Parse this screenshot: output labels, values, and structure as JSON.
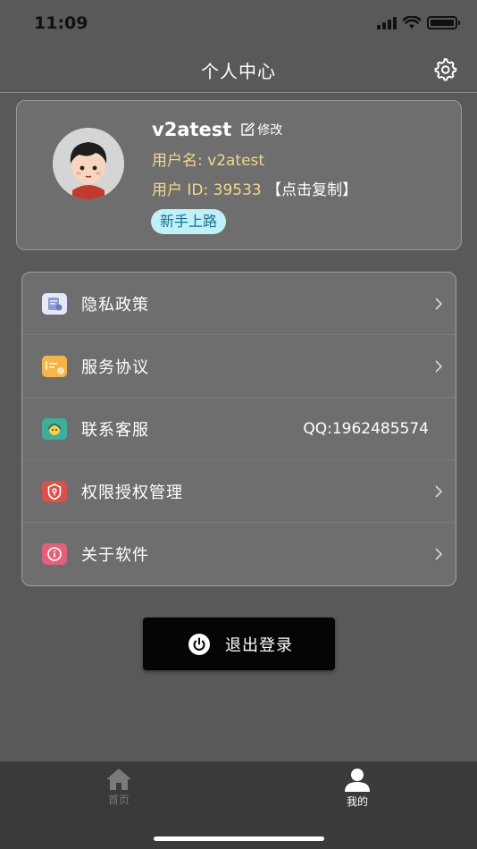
{
  "status_bar": {
    "time": "11:09"
  },
  "nav": {
    "title": "个人中心"
  },
  "profile": {
    "username": "v2atest",
    "edit_label": "修改",
    "username_line": "用户名: v2atest",
    "user_id_line": "用户 ID: 39533",
    "copy_label": "【点击复制】",
    "badge": "新手上路"
  },
  "menu": {
    "items": [
      {
        "label": "隐私政策",
        "icon": "privacy-policy-icon"
      },
      {
        "label": "服务协议",
        "icon": "service-agreement-icon"
      },
      {
        "label": "联系客服",
        "icon": "customer-service-icon",
        "value": "QQ:1962485574"
      },
      {
        "label": "权限授权管理",
        "icon": "permission-management-icon"
      },
      {
        "label": "关于软件",
        "icon": "about-icon"
      }
    ]
  },
  "logout": {
    "label": "退出登录"
  },
  "tabs": [
    {
      "label": "首页",
      "icon": "home-icon",
      "active": false
    },
    {
      "label": "我的",
      "icon": "profile-icon",
      "active": true
    }
  ],
  "colors": {
    "background": "#595959",
    "card": "#6e6e6e",
    "info_text": "#f0d98a",
    "badge_bg": "#bff1f6",
    "badge_text": "#1a6f92",
    "tab_bar": "#3a3a3a"
  }
}
